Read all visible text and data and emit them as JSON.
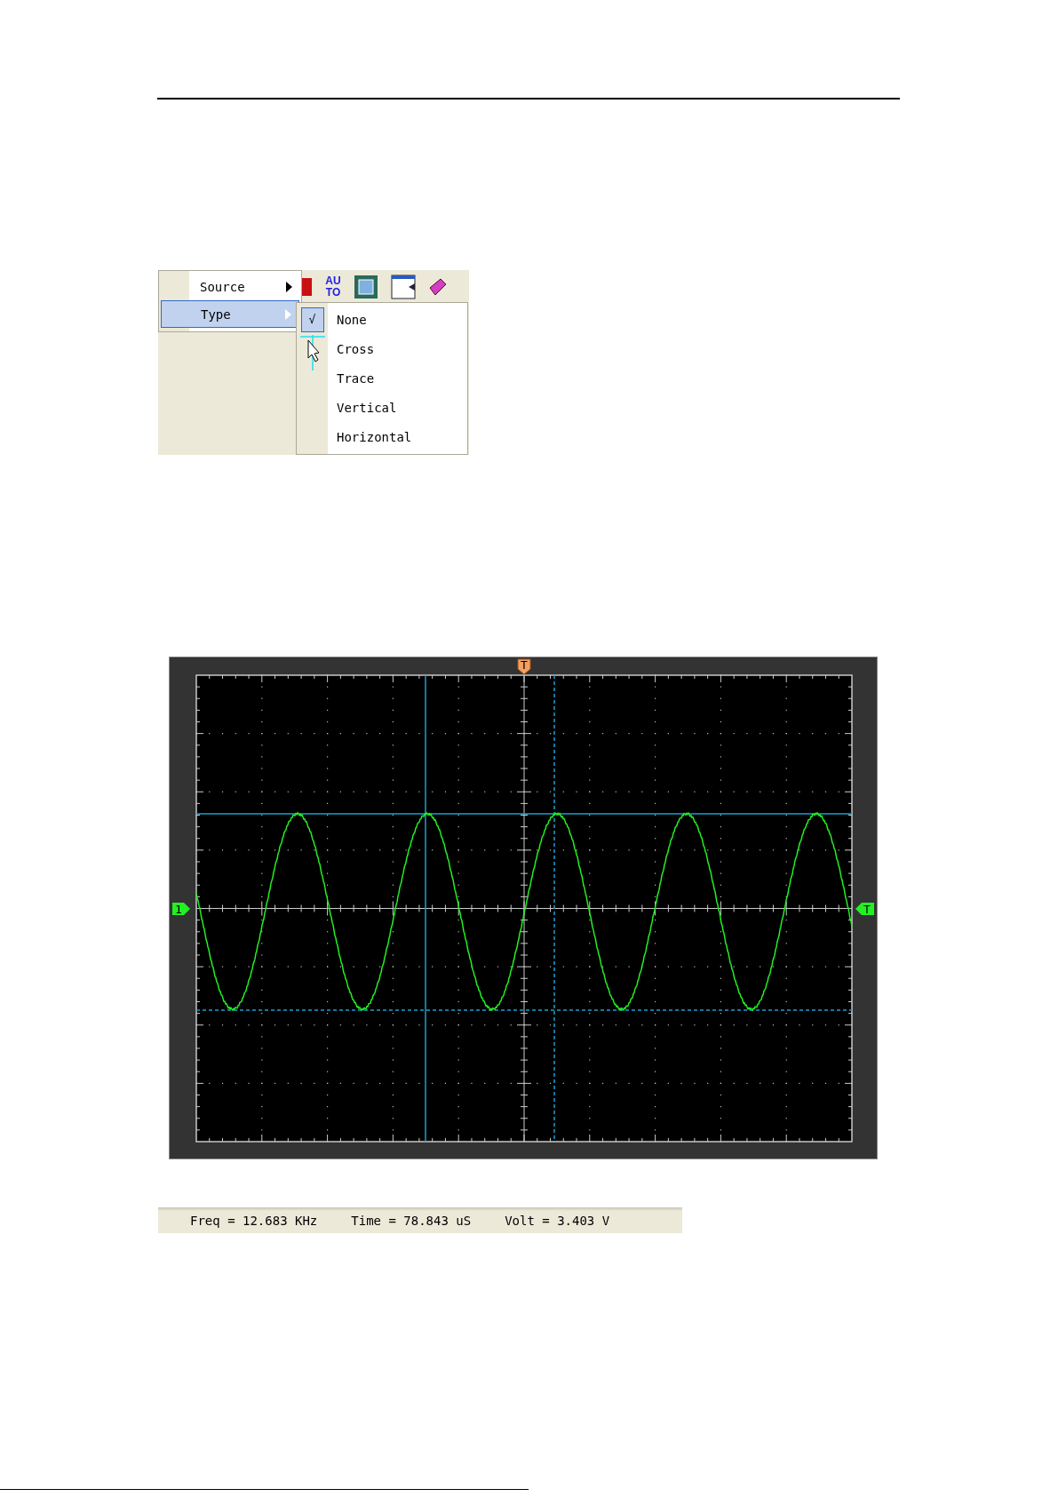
{
  "menu_screenshot": {
    "toolbar": {
      "auto_label": "AUTO"
    },
    "menu": [
      {
        "label": "Source",
        "selected": false,
        "submenu_arrow": true
      },
      {
        "label": "Type",
        "selected": true,
        "submenu_arrow": true
      }
    ],
    "check_mark": "√",
    "submenu": [
      {
        "label": "None",
        "checked": true
      },
      {
        "label": "Cross",
        "checked": false
      },
      {
        "label": "Trace",
        "checked": false
      },
      {
        "label": "Vertical",
        "checked": false
      },
      {
        "label": "Horizontal",
        "checked": false
      }
    ]
  },
  "scope": {
    "top_marker": "T",
    "channel_marker": "1",
    "trigger_level_marker": "T"
  },
  "status_bar": {
    "readings": [
      "Freq = 12.683 KHz",
      "Time = 78.843 uS",
      "Volt = 3.403 V"
    ]
  }
}
